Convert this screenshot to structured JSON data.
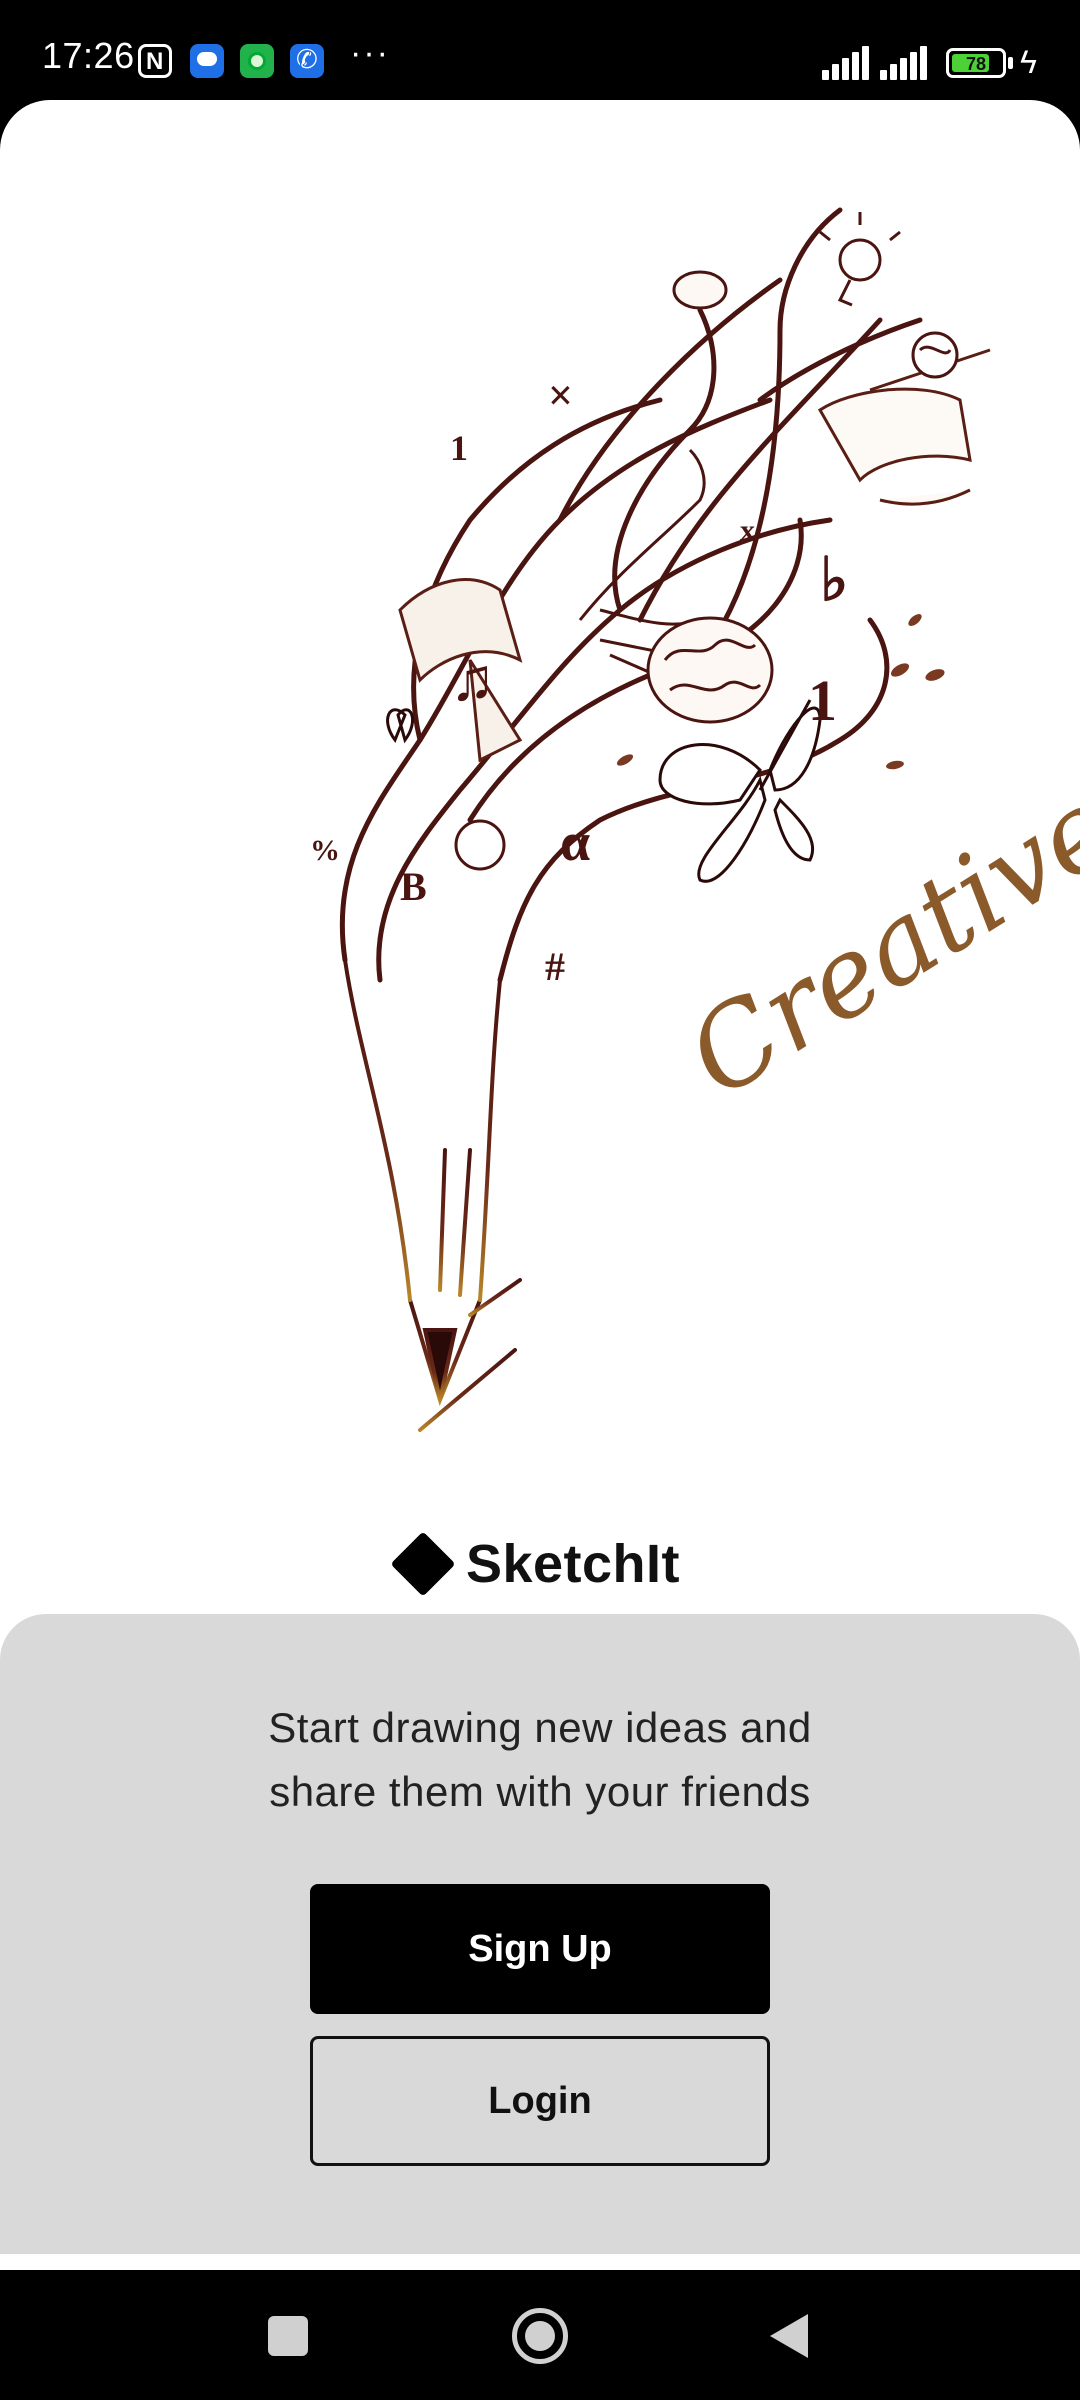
{
  "status_bar": {
    "time": "17:26",
    "icons": [
      "nfc-icon",
      "messages-icon",
      "cat-app-icon",
      "phone-icon"
    ],
    "more": "···",
    "battery_level": "78",
    "charging": true
  },
  "hero": {
    "illustration": "pencil-sketch-illustration",
    "script_text": "Creative Wor"
  },
  "brand": {
    "name": "SketchIt"
  },
  "welcome": {
    "tagline_line1": "Start drawing new ideas and",
    "tagline_line2": "share them with your friends",
    "signup_label": "Sign Up",
    "login_label": "Login"
  },
  "nav_bar": {
    "buttons": [
      "recents-icon",
      "home-icon",
      "back-icon"
    ]
  },
  "colors": {
    "panel_bg": "#d9d9d9",
    "primary_button": "#000000",
    "sketch_ink": "#5a1e14",
    "sketch_gold": "#b8862a"
  }
}
